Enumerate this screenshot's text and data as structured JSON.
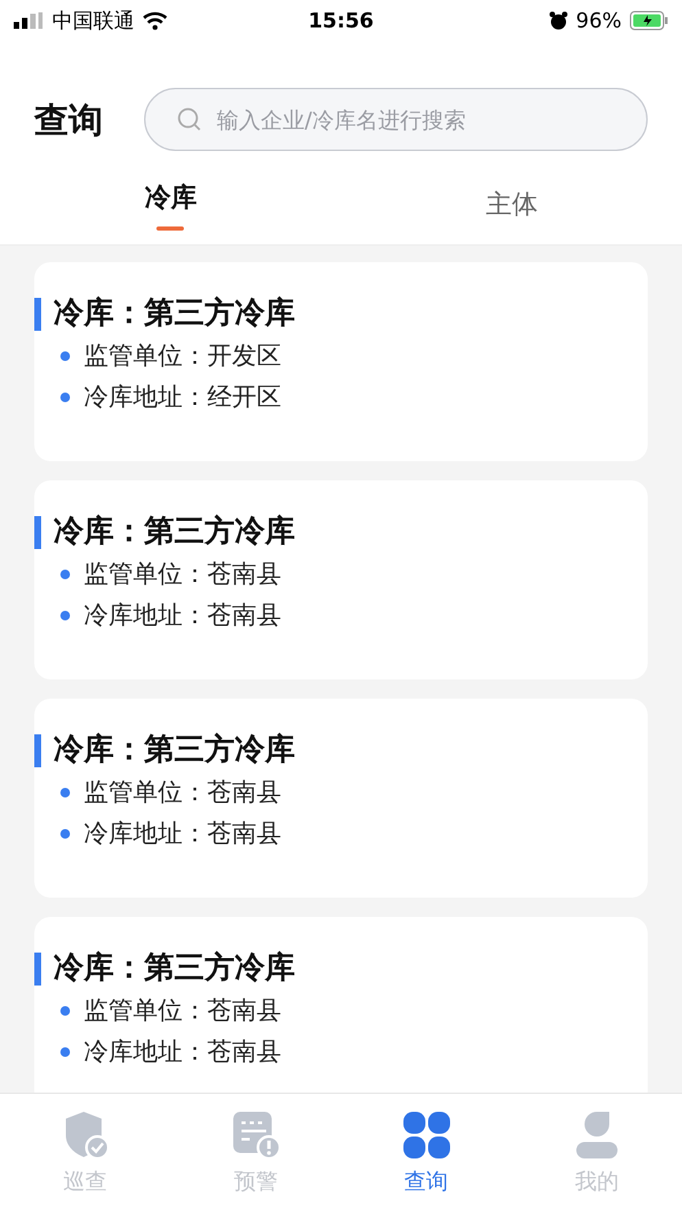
{
  "status_bar": {
    "carrier": "中国联通",
    "time": "15:56",
    "battery": "96%"
  },
  "header": {
    "title": "查询",
    "search": {
      "placeholder": "输入企业/冷库名进行搜索"
    }
  },
  "tabs": [
    {
      "label": "冷库",
      "selected": true
    },
    {
      "label": "主体",
      "selected": false
    }
  ],
  "cards": [
    {
      "title": "冷库：第三方冷库",
      "lines": [
        "监管单位：开发区",
        "冷库地址：经开区"
      ]
    },
    {
      "title": "冷库：第三方冷库",
      "lines": [
        "监管单位：苍南县",
        "冷库地址：苍南县"
      ]
    },
    {
      "title": "冷库：第三方冷库",
      "lines": [
        "监管单位：苍南县",
        "冷库地址：苍南县"
      ]
    },
    {
      "title": "冷库：第三方冷库",
      "lines": [
        "监管单位：苍南县",
        "冷库地址：苍南县"
      ]
    }
  ],
  "nav": [
    {
      "kind": "patrol",
      "label": "巡查",
      "selected": false
    },
    {
      "kind": "warning",
      "label": "预警",
      "selected": false
    },
    {
      "kind": "query",
      "label": "查询",
      "selected": true
    },
    {
      "kind": "mine",
      "label": "我的",
      "selected": false
    }
  ]
}
